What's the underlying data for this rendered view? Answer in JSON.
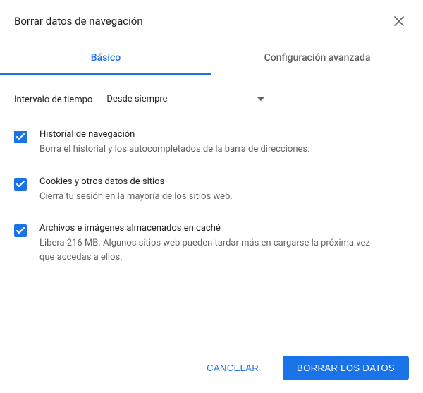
{
  "dialog": {
    "title": "Borrar datos de navegación"
  },
  "tabs": {
    "basic": "Básico",
    "advanced": "Configuración avanzada"
  },
  "time_range": {
    "label": "Intervalo de tiempo",
    "selected": "Desde siempre"
  },
  "options": [
    {
      "title": "Historial de navegación",
      "description": "Borra el historial y los autocompletados de la barra de direcciones.",
      "checked": true
    },
    {
      "title": "Cookies y otros datos de sitios",
      "description": "Cierra tu sesión en la mayoría de los sitios web.",
      "checked": true
    },
    {
      "title": "Archivos e imágenes almacenados en caché",
      "description": "Libera 216 MB. Algunos sitios web pueden tardar más en cargarse la próxima vez que accedas a ellos.",
      "checked": true
    }
  ],
  "buttons": {
    "cancel": "CANCELAR",
    "confirm": "BORRAR LOS DATOS"
  }
}
